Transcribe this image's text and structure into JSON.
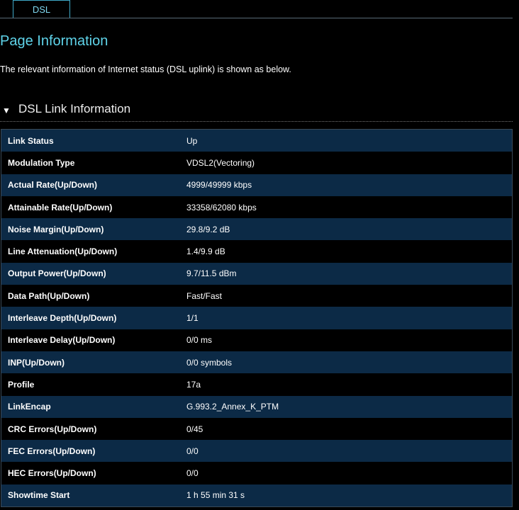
{
  "tabs": [
    {
      "label": "DSL",
      "active": true
    }
  ],
  "page_title": "Page Information",
  "description": "The relevant information of Internet status (DSL uplink) is shown as below.",
  "section": {
    "title": "DSL Link Information",
    "expanded": true
  },
  "rows": [
    {
      "label": "Link Status",
      "value": "Up"
    },
    {
      "label": "Modulation Type",
      "value": "VDSL2(Vectoring)"
    },
    {
      "label": "Actual Rate(Up/Down)",
      "value": "4999/49999 kbps"
    },
    {
      "label": "Attainable Rate(Up/Down)",
      "value": "33358/62080 kbps"
    },
    {
      "label": "Noise Margin(Up/Down)",
      "value": "29.8/9.2 dB"
    },
    {
      "label": "Line Attenuation(Up/Down)",
      "value": "1.4/9.9 dB"
    },
    {
      "label": "Output Power(Up/Down)",
      "value": "9.7/11.5 dBm"
    },
    {
      "label": "Data Path(Up/Down)",
      "value": "Fast/Fast"
    },
    {
      "label": "Interleave Depth(Up/Down)",
      "value": "1/1"
    },
    {
      "label": "Interleave Delay(Up/Down)",
      "value": "0/0 ms"
    },
    {
      "label": "INP(Up/Down)",
      "value": "0/0 symbols"
    },
    {
      "label": "Profile",
      "value": "17a"
    },
    {
      "label": "LinkEncap",
      "value": "G.993.2_Annex_K_PTM"
    },
    {
      "label": "CRC Errors(Up/Down)",
      "value": "0/45"
    },
    {
      "label": "FEC Errors(Up/Down)",
      "value": "0/0"
    },
    {
      "label": "HEC Errors(Up/Down)",
      "value": "0/0"
    },
    {
      "label": "Showtime Start",
      "value": "1 h 55 min 31 s"
    }
  ]
}
